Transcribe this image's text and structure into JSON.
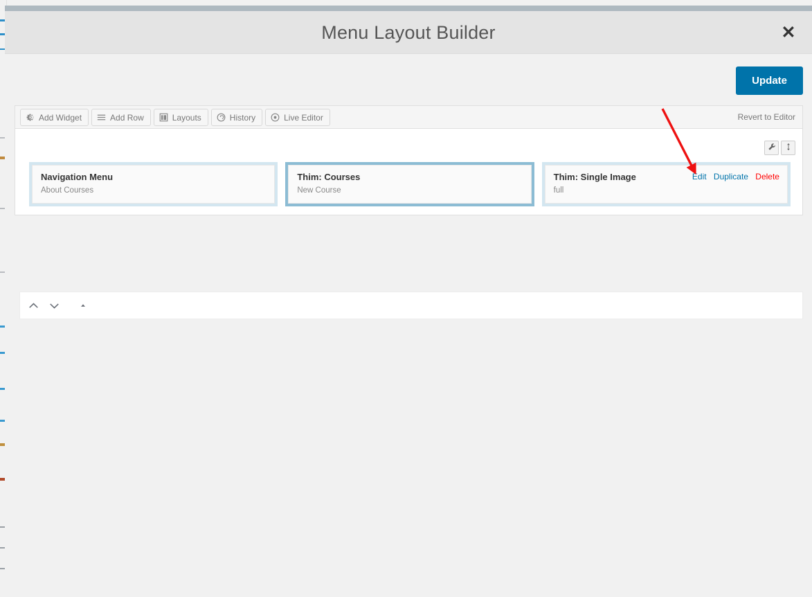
{
  "window": {
    "title": "Menu Layout Builder",
    "close_label": "✕"
  },
  "actions": {
    "update_label": "Update",
    "revert_label": "Revert to Editor"
  },
  "toolbar": {
    "buttons": [
      {
        "label": "Add Widget",
        "icon": "gear-icon"
      },
      {
        "label": "Add Row",
        "icon": "hamburger-icon"
      },
      {
        "label": "Layouts",
        "icon": "layouts-grid-icon"
      },
      {
        "label": "History",
        "icon": "history-undo-icon"
      },
      {
        "label": "Live Editor",
        "icon": "eye-target-icon"
      }
    ]
  },
  "row": {
    "controls": [
      {
        "name": "row-settings",
        "icon": "wrench-icon"
      },
      {
        "name": "row-move",
        "icon": "move-vertical-icon"
      }
    ],
    "cells": [
      {
        "title": "Navigation Menu",
        "subtitle": "About Courses",
        "active": false,
        "show_actions": false
      },
      {
        "title": "Thim: Courses",
        "subtitle": "New Course",
        "active": true,
        "show_actions": false
      },
      {
        "title": "Thim: Single Image",
        "subtitle": "full",
        "active": false,
        "show_actions": true,
        "actions": {
          "edit": "Edit",
          "duplicate": "Duplicate",
          "delete": "Delete"
        }
      }
    ]
  },
  "bottom_bar": {
    "controls": [
      {
        "name": "move-up-chevron",
        "icon": "chevron-up-icon"
      },
      {
        "name": "move-down-chevron",
        "icon": "chevron-down-icon"
      },
      {
        "name": "collapse-triangle",
        "icon": "triangle-up-icon"
      }
    ]
  },
  "colors": {
    "accent": "#0073aa",
    "delete": "#ff0000",
    "cell_bg": "#d3e6f0",
    "cell_active_bg": "#8cbcd4",
    "annotation_arrow": "#ee1111"
  }
}
